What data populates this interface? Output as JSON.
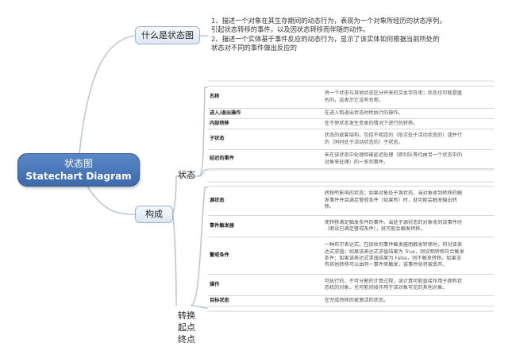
{
  "root": {
    "line1": "状态图",
    "line2": "Statechart Diagram"
  },
  "what_is": {
    "label": "什么是状态图",
    "points": [
      "1、描述一个对象在其生存期间的动态行为，表现为一个对象所经历的状态序列，",
      "引起状态转移的事件，以及因状态转移而伴随的动作。",
      "2、描述一个实体基于事件反应的动态行为，显示了该实体如何根据当前所处的",
      "状态对不同的事件做出反应的"
    ]
  },
  "composition": {
    "label": "构成",
    "state": {
      "label": "状态",
      "rows": [
        {
          "name": "名称",
          "desc": [
            "将一个状态与其他状态区分开来的文本字符串；状态也可能是匿",
            "名的，这表示它没有名称。"
          ]
        },
        {
          "name": "进入/退出操作",
          "desc": [
            "在进入和退出状态时所执行的操作。"
          ]
        },
        {
          "name": "内部转移",
          "desc": [
            "在不使状态发生变更的情况下进行的转移。"
          ]
        },
        {
          "name": "子状态",
          "desc": [
            "状态的嵌套结构，包括不相连的（依次处于活动状态的）或并行",
            "的（同时处于活动状态的）子状态。"
          ]
        },
        {
          "name": "延迟的事件",
          "desc": [
            "未在该状态中处理但被延迟处理（即列队等待由另一个状态中的",
            "对象来处理）的一系列事件。"
          ]
        }
      ]
    },
    "transition": {
      "labels": [
        "转换",
        "起点",
        "终点"
      ],
      "rows": [
        {
          "name": "源状态",
          "desc": [
            "转移所影响的状态；如果对象处于源状态，当对象收到转移的触",
            "发事件并且满足警戒条件（如果有）时，就可能会触发输出转",
            "移。"
          ]
        },
        {
          "name": "事件触发器",
          "desc": [
            "使转移满足触发条件的事件。当处于源状态的对象收到该事件时",
            "（假设已满足警戒条件），就可能会触发转移。"
          ]
        },
        {
          "name": "警戒条件",
          "desc": [
            "一种布尔表达式。在接收到事件触发器而触发转移时，将对该表",
            "达式求值；如果该表达式求值结果为 True，则说明转移符合触发",
            "条件；如果该表达式求值结果为 False，则不触发转移。如果没",
            "有其他转移可以由同一事件来触发，该事件就将被丢弃。"
          ]
        },
        {
          "name": "操作",
          "desc": [
            "可执行的、不可分割的计算过程，该计算可能直接作用于拥有状",
            "态机的对象，也可能间接作用于该对象可见的其他对象。"
          ]
        },
        {
          "name": "目标状态",
          "desc": [
            "在完成转移后被激活的状态。"
          ]
        }
      ]
    }
  },
  "colors": {
    "root_fill": "#4a78b8",
    "topic_fill": "#e6edf8",
    "connector": "#b9c6d8"
  }
}
